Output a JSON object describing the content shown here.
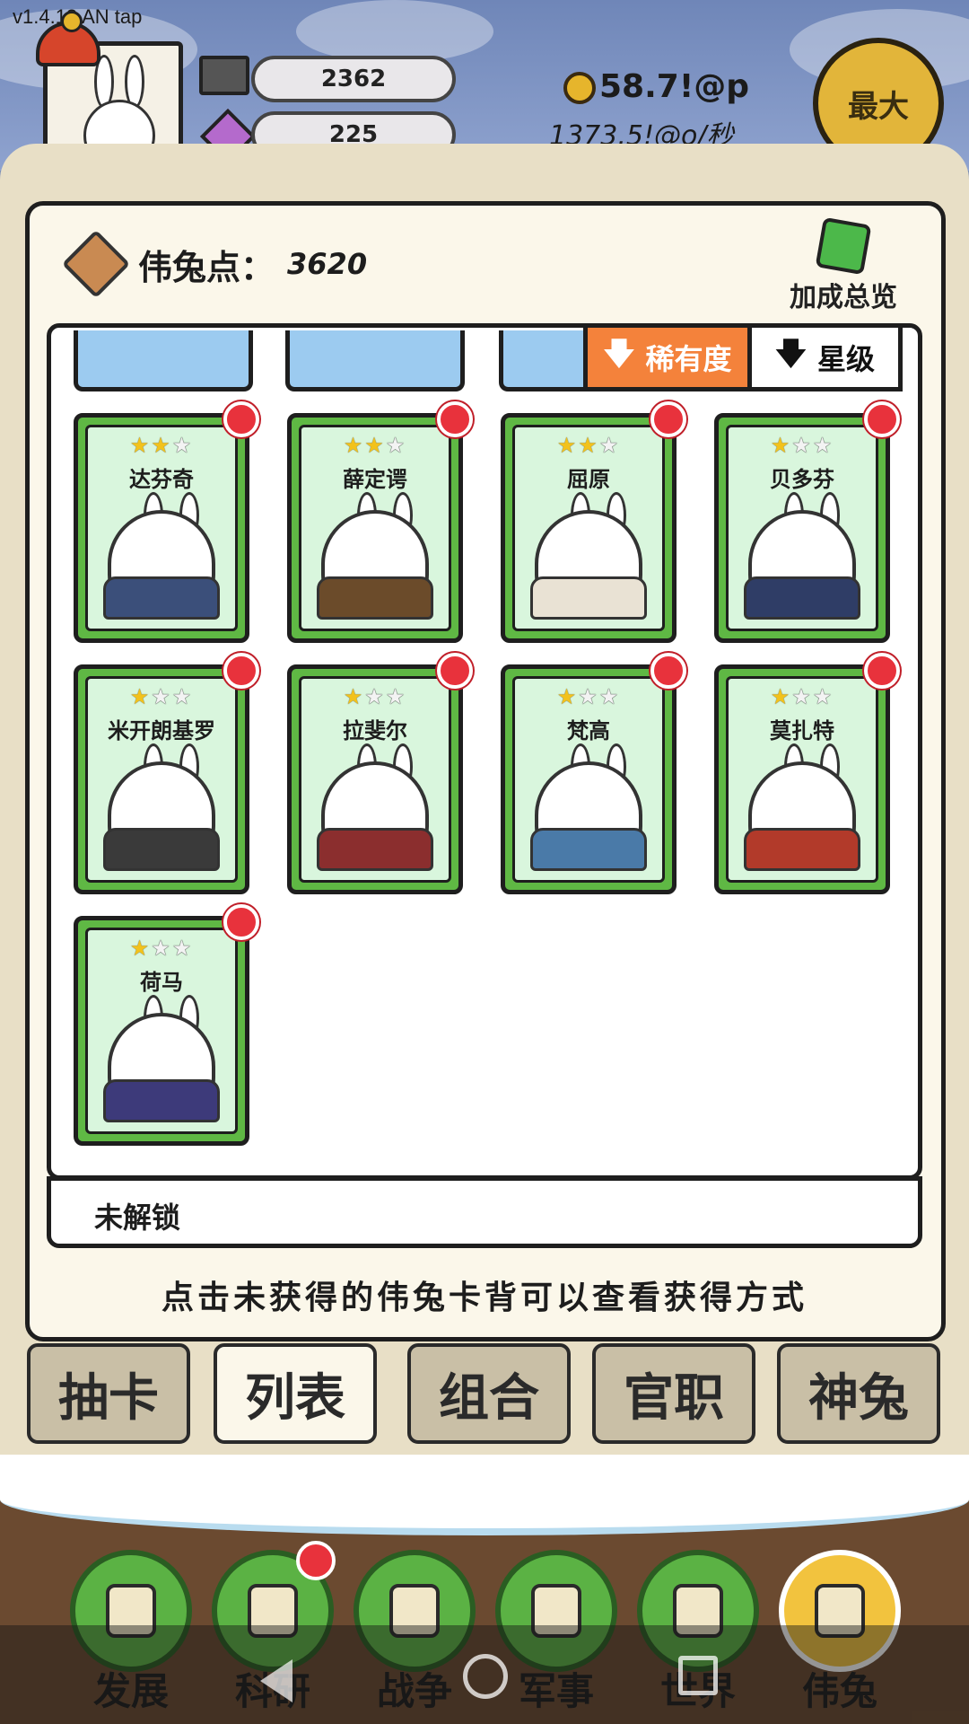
{
  "version": "v1.4.13 AN tap",
  "resources": {
    "stone": "2362",
    "crystal": "225"
  },
  "gold": {
    "amount": "58.7!@p",
    "rate": "1373.5!@o/秒"
  },
  "max_button": "最大",
  "panel": {
    "points_label": "伟兔点：",
    "points_value": "3620",
    "bonus_label": "加成总览",
    "sort_rarity": "稀有度",
    "sort_star": "星级",
    "locked_label": "未解锁",
    "hint": "点击未获得的伟兔卡背可以查看获得方式"
  },
  "cards": [
    {
      "name": "达芬奇",
      "stars": 2,
      "max_stars": 3,
      "outfit_color": "#3b4f7a"
    },
    {
      "name": "薛定谔",
      "stars": 2,
      "max_stars": 3,
      "outfit_color": "#6b4b2a"
    },
    {
      "name": "屈原",
      "stars": 2,
      "max_stars": 3,
      "outfit_color": "#e9e2d4"
    },
    {
      "name": "贝多芬",
      "stars": 1,
      "max_stars": 3,
      "outfit_color": "#2f3d66"
    },
    {
      "name": "米开朗基罗",
      "stars": 1,
      "max_stars": 3,
      "outfit_color": "#3a3a3a"
    },
    {
      "name": "拉斐尔",
      "stars": 1,
      "max_stars": 3,
      "outfit_color": "#8b2e2e"
    },
    {
      "name": "梵高",
      "stars": 1,
      "max_stars": 3,
      "outfit_color": "#4a7aa8"
    },
    {
      "name": "莫扎特",
      "stars": 1,
      "max_stars": 3,
      "outfit_color": "#b23a2a"
    },
    {
      "name": "荷马",
      "stars": 1,
      "max_stars": 3,
      "outfit_color": "#3d3a7a"
    }
  ],
  "sub_tabs": [
    "抽卡",
    "列表",
    "组合",
    "官职",
    "神兔"
  ],
  "active_sub_tab": "列表",
  "nav": [
    {
      "label": "发展",
      "icon": "growth-icon"
    },
    {
      "label": "科研",
      "icon": "flask-icon",
      "badge": true
    },
    {
      "label": "战争",
      "icon": "swords-icon"
    },
    {
      "label": "军事",
      "icon": "helmet-icon"
    },
    {
      "label": "世界",
      "icon": "globe-icon"
    },
    {
      "label": "伟兔",
      "icon": "portrait-icon",
      "active": true
    }
  ],
  "colors": {
    "accent_orange": "#f4823b",
    "card_green": "#5fb844",
    "badge_red": "#e8323c",
    "gold": "#e2b53a"
  }
}
